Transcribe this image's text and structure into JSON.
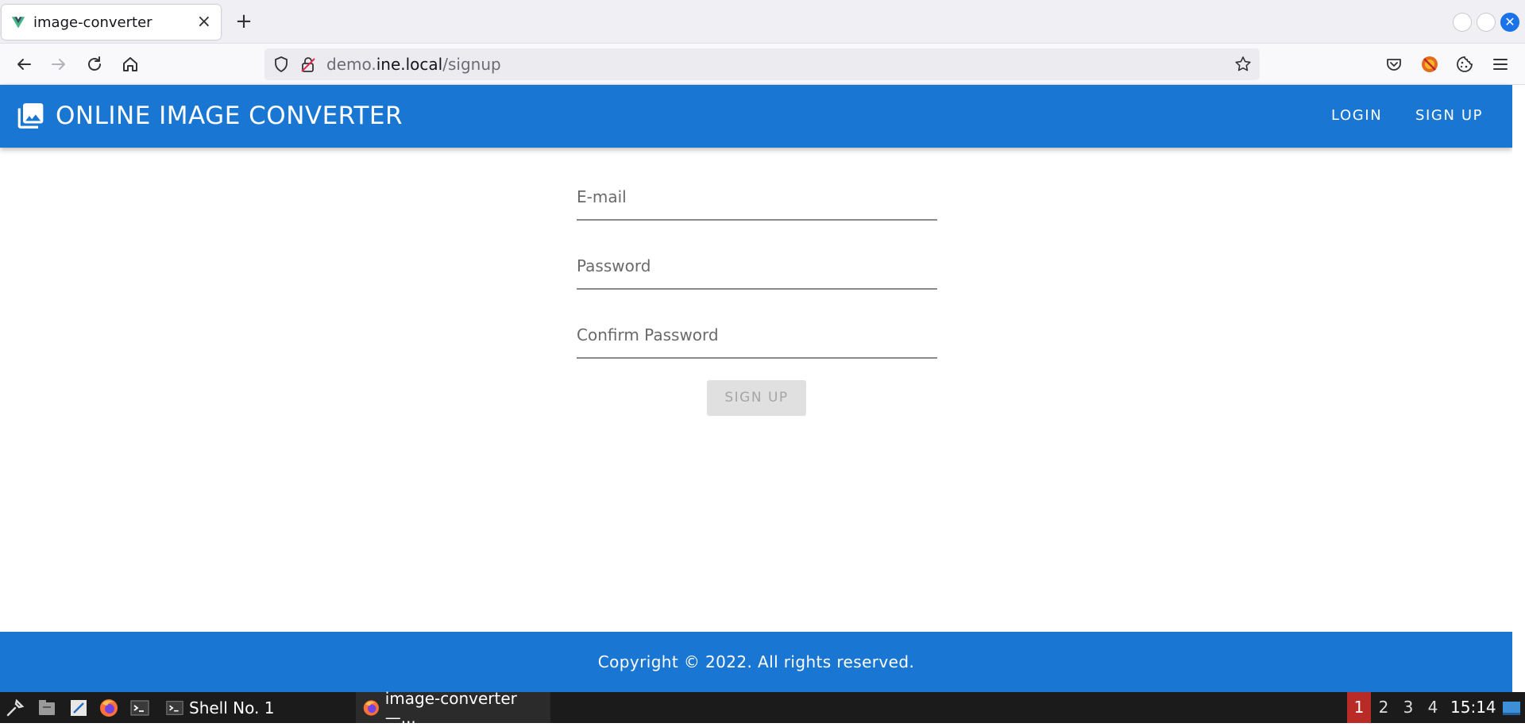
{
  "browser": {
    "tab_title": "image-converter",
    "tab_close": "×",
    "new_tab": "+",
    "url_prefix": "demo.",
    "url_host": "ine.local",
    "url_path": "/signup"
  },
  "app": {
    "title": "ONLINE IMAGE CONVERTER",
    "nav": {
      "login": "LOGIN",
      "signup": "SIGN UP"
    },
    "brand_color": "#1976d2"
  },
  "form": {
    "email_label": "E-mail",
    "password_label": "Password",
    "confirm_label": "Confirm Password",
    "submit_label": "SIGN UP"
  },
  "footer": {
    "text": "Copyright © 2022. All rights reserved."
  },
  "taskbar": {
    "shell_label": "Shell No. 1",
    "browser_label": "image-converter —...",
    "workspaces": [
      "1",
      "2",
      "3",
      "4"
    ],
    "active_workspace": "1",
    "clock": "15:14"
  }
}
